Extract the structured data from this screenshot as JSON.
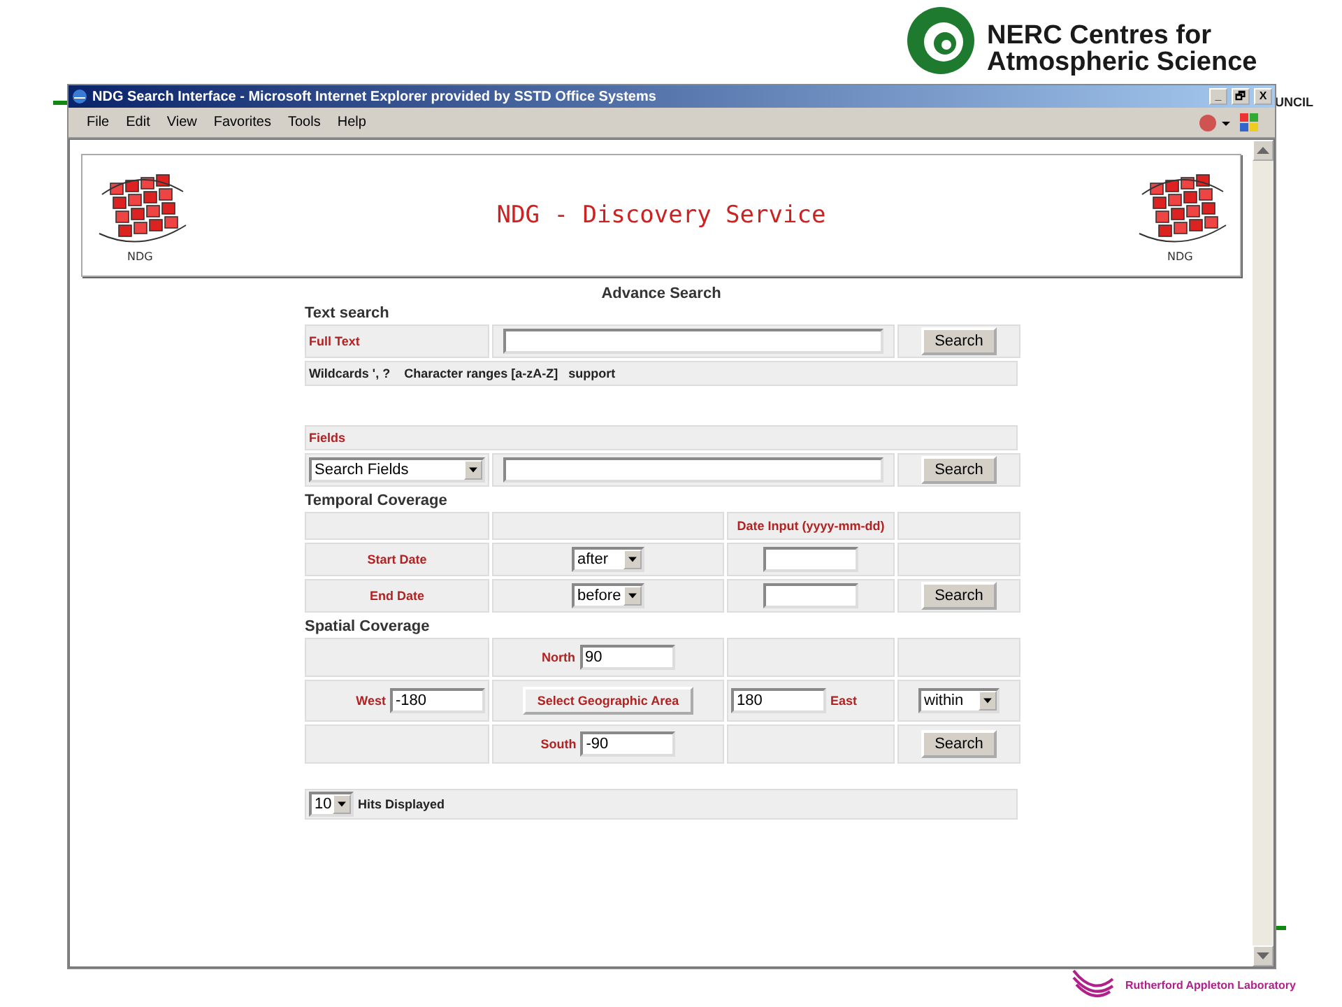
{
  "slide": {
    "org_name": "NERC Centres for",
    "org_name_2": "Atmospheric Science",
    "council_fragment": "UNCIL",
    "lab_name": "Rutherford Appleton Laboratory"
  },
  "window": {
    "title": "NDG Search Interface - Microsoft Internet Explorer provided by SSTD Office Systems",
    "controls": [
      "_",
      "🗗",
      "X"
    ]
  },
  "menu": [
    {
      "label": "File"
    },
    {
      "label": "Edit"
    },
    {
      "label": "View"
    },
    {
      "label": "Favorites"
    },
    {
      "label": "Tools"
    },
    {
      "label": "Help"
    }
  ],
  "banner": {
    "title": "NDG - Discovery Service",
    "logo_texts": [
      "NDG",
      "NDG"
    ]
  },
  "heading": "Advance Search",
  "text_search": {
    "title": "Text search",
    "label": "Full Text",
    "button": "Search",
    "hint": "Wildcards ', ?    Character ranges [a-zA-Z]   support"
  },
  "fields": {
    "label": "Fields",
    "select": "Search Fields",
    "button": "Search"
  },
  "temporal": {
    "title": "Temporal Coverage",
    "column_header": "Date Input (yyyy-mm-dd)",
    "rows": [
      {
        "label": "Start Date",
        "select": "after"
      },
      {
        "label": "End Date",
        "select": "before"
      }
    ],
    "button": "Search"
  },
  "spatial": {
    "title": "Spatial Coverage",
    "north_label": "North",
    "north": "90",
    "west_label": "West",
    "west": "-180",
    "area_button": "Select Geographic Area",
    "east": "180",
    "east_label": "East",
    "mode": "within",
    "south_label": "South",
    "south": "-90",
    "button": "Search"
  },
  "hits": {
    "select": "10",
    "label": "Hits Displayed"
  }
}
